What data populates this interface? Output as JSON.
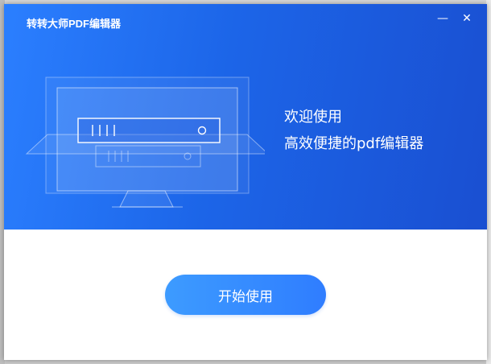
{
  "window": {
    "title": "转转大师PDF编辑器",
    "minimize_icon": "minimize-icon",
    "close_icon": "close-icon",
    "minimize_glyph": "—",
    "close_glyph": "✕"
  },
  "hero": {
    "welcome_line1": "欢迎使用",
    "welcome_line2": "高效便捷的pdf编辑器",
    "illustration_icon": "monitor-server-illustration"
  },
  "actions": {
    "start_label": "开始使用"
  },
  "colors": {
    "accent": "#2f7dff",
    "hero_start": "#2b7fff",
    "hero_end": "#1a4fd1"
  }
}
